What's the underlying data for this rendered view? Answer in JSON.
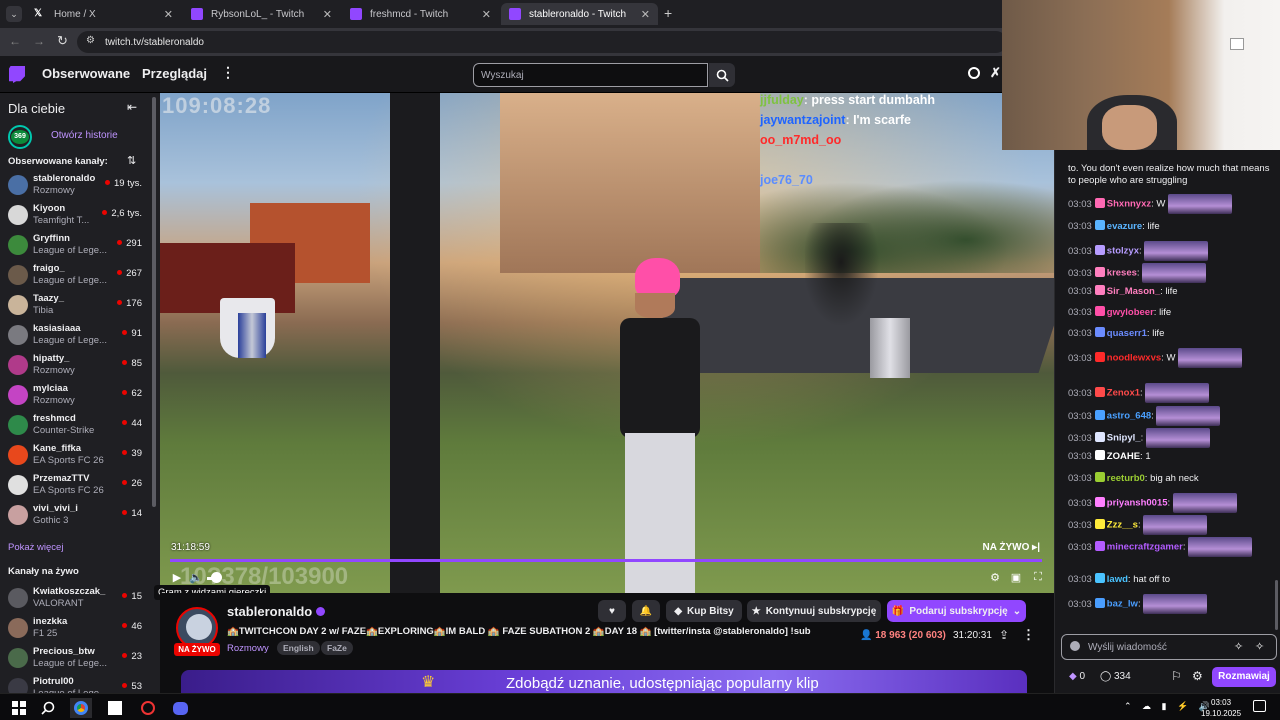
{
  "browser": {
    "tabs": [
      {
        "label": "Home / X",
        "active": false
      },
      {
        "label": "RybsonLoL_ - Twitch",
        "active": false
      },
      {
        "label": "freshmcd - Twitch",
        "active": false
      },
      {
        "label": "stableronaldo - Twitch",
        "active": true
      }
    ],
    "url": "twitch.tv/stableronaldo"
  },
  "nav": {
    "following": "Obserwowane",
    "browse": "Przeglądaj",
    "search_placeholder": "Wyszukaj"
  },
  "sidebar": {
    "for_you": "Dla ciebie",
    "stories_count": "369",
    "open_stories": "Otwórz historie",
    "followed_header": "Obserwowane kanały:",
    "followed": [
      {
        "name": "stableronaldo",
        "game": "Rozmowy",
        "viewers": "19 tys.",
        "color": "#4a6fa5"
      },
      {
        "name": "Kiyoon",
        "game": "Teamfight T...",
        "viewers": "2,6 tys.",
        "color": "#d8d8d8"
      },
      {
        "name": "Gryffinn",
        "game": "League of Lege...",
        "viewers": "291",
        "color": "#3c8a3c"
      },
      {
        "name": "fraigo_",
        "game": "League of Lege...",
        "viewers": "267",
        "color": "#6b5a4a"
      },
      {
        "name": "Taazy_",
        "game": "Tibia",
        "viewers": "176",
        "color": "#c9b49a"
      },
      {
        "name": "kasiasiaaa",
        "game": "League of Lege...",
        "viewers": "91",
        "color": "#7a7a80"
      },
      {
        "name": "hipatty_",
        "game": "Rozmowy",
        "viewers": "85",
        "color": "#b03a8a"
      },
      {
        "name": "mylciaa",
        "game": "Rozmowy",
        "viewers": "62",
        "color": "#c444c4"
      },
      {
        "name": "freshmcd",
        "game": "Counter-Strike",
        "viewers": "44",
        "color": "#2e8a4a"
      },
      {
        "name": "Kane_fifka",
        "game": "EA Sports FC 26",
        "viewers": "39",
        "color": "#e8481c"
      },
      {
        "name": "PrzemazTTV",
        "game": "EA Sports FC 26",
        "viewers": "26",
        "color": "#e0e0e0"
      },
      {
        "name": "vivi_vivi_i",
        "game": "Gothic 3",
        "viewers": "14",
        "color": "#c8a0a0"
      }
    ],
    "show_more": "Pokaż więcej",
    "live_header": "Kanały na żywo",
    "live": [
      {
        "name": "Kwiatkoszczak_",
        "game": "VALORANT",
        "viewers": "15",
        "color": "#5a5a60"
      },
      {
        "name": "inezkka",
        "game": "F1 25",
        "viewers": "46",
        "color": "#8a6a5a"
      },
      {
        "name": "Precious_btw",
        "game": "League of Lege...",
        "viewers": "23",
        "color": "#4a6a4a"
      },
      {
        "name": "Piotrul00",
        "game": "League of Lege...",
        "viewers": "53",
        "color": "#3a3a44"
      }
    ]
  },
  "video": {
    "timestamp_overlay": "109:08:28",
    "overlay_chat": [
      {
        "user": "jjfulday",
        "text": "press start dumbahh",
        "color": "#7fc242"
      },
      {
        "user": "jaywantzajoint",
        "text": "I'm scarfe",
        "color": "#1e64ff"
      },
      {
        "user": "oo_m7md_oo",
        "text": "",
        "color": "#ff2a2a"
      },
      {
        "user": "",
        "text": "",
        "color": "#ffffff"
      },
      {
        "user": "joe76_70",
        "text": "",
        "color": "#5a8cff"
      }
    ],
    "elapsed": "31:18:59",
    "live_label": "NA ŻYWO",
    "bottom_counter": "10?378/103900",
    "tooltip": "Gram z widzami giereczki"
  },
  "stream": {
    "channel": "stableronaldo",
    "live_badge": "NA ŻYWO",
    "title": "🏫TWITCHCON DAY 2 w/ FAZE🏫EXPLORING🏫IM BALD 🏫 FAZE SUBATHON 2 🏫DAY 18 🏫 [twitter/insta @stableronaldo] !sub",
    "category": "Rozmowy",
    "tags": [
      "English",
      "FaZe"
    ],
    "bits_label": "Kup Bitsy",
    "continue_sub": "Kontynuuj subskrypcję",
    "gift_sub": "Podaruj subskrypcję",
    "viewers": "18 963 (20 603)",
    "uptime": "31:20:31",
    "banner_text": "Zdobądź uznanie, udostępniając popularny klip"
  },
  "chat": {
    "top_text": "to. You don't even realize how much that means to people who are struggling",
    "messages": [
      {
        "time": "03:03",
        "user": "Shxnnyxz",
        "color": "#ff69b4",
        "text": "W",
        "emote": true
      },
      {
        "time": "03:03",
        "user": "evazure",
        "color": "#5ab4ff",
        "text": "life",
        "emote": false
      },
      {
        "time": "03:03",
        "user": "stolzyx",
        "color": "#b69cff",
        "text": "",
        "emote": true
      },
      {
        "time": "03:03",
        "user": "kreses",
        "color": "#ff7fbf",
        "text": "",
        "emote": true
      },
      {
        "time": "03:03",
        "user": "Sir_Mason_",
        "color": "#ff7fbf",
        "text": "life",
        "emote": false
      },
      {
        "time": "03:03",
        "user": "gwylobeer",
        "color": "#ff4fa8",
        "text": "life",
        "emote": false
      },
      {
        "time": "03:03",
        "user": "quaserr1",
        "color": "#6b8cff",
        "text": "life",
        "emote": false
      },
      {
        "time": "03:03",
        "user": "noodlewxvs",
        "color": "#ff2a2a",
        "text": "W",
        "emote": true
      },
      {
        "time": "03:03",
        "user": "Zenox1",
        "color": "#ff4a4a",
        "text": "",
        "emote": true
      },
      {
        "time": "03:03",
        "user": "astro_648",
        "color": "#4aa0ff",
        "text": "",
        "emote": true
      },
      {
        "time": "03:03",
        "user": "Snipyl_",
        "color": "#dfe6ff",
        "text": "",
        "emote": true
      },
      {
        "time": "03:03",
        "user": "ZOAHE",
        "color": "#ffffff",
        "text": "1",
        "emote": false
      },
      {
        "time": "03:03",
        "user": "reeturb0",
        "color": "#9acd32",
        "text": "big ah neck",
        "emote": false
      },
      {
        "time": "03:03",
        "user": "priyansh0015",
        "color": "#ff7fff",
        "text": "",
        "emote": true
      },
      {
        "time": "03:03",
        "user": "Zzz__s",
        "color": "#ffeb3b",
        "text": "",
        "emote": true
      },
      {
        "time": "03:03",
        "user": "minecraftzgamer",
        "color": "#b35cff",
        "text": "",
        "emote": true
      },
      {
        "time": "03:03",
        "user": "lawd",
        "color": "#4ac3ff",
        "text": "hat off to",
        "emote": false
      },
      {
        "time": "03:03",
        "user": "baz_lw",
        "color": "#4a9eff",
        "text": "",
        "emote": true
      }
    ],
    "input_placeholder": "Wyślij wiadomość",
    "points": "0",
    "channel_points": "334",
    "send_label": "Rozmawiaj"
  },
  "taskbar": {
    "time": "03:03",
    "date": "19.10.2025"
  },
  "colors": {
    "accent": "#9147ff",
    "live": "#eb0400",
    "link": "#bf94ff"
  }
}
